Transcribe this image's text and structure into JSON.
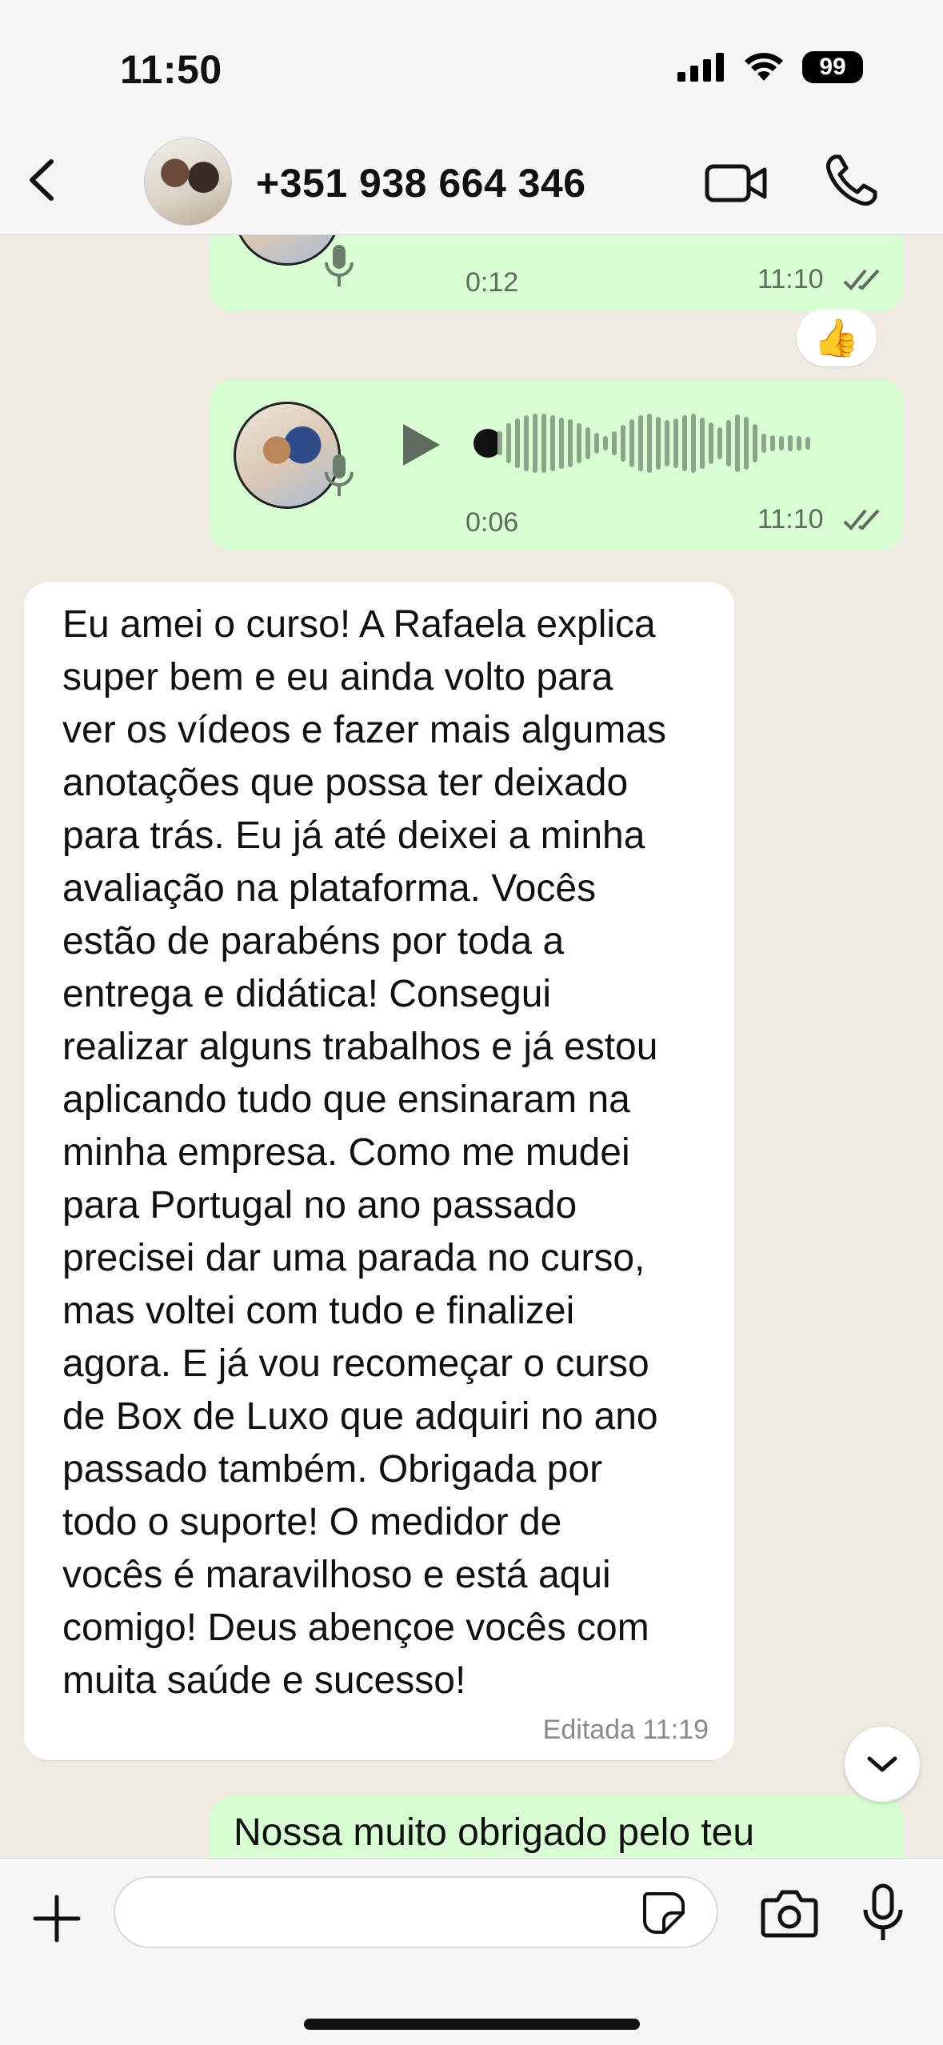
{
  "status_bar": {
    "time": "11:50",
    "battery": "99"
  },
  "header": {
    "contact_name": "+351 938 664 346"
  },
  "messages": {
    "voice_1": {
      "duration": "0:12",
      "time": "11:10",
      "reaction": "👍"
    },
    "voice_2": {
      "duration": "0:06",
      "time": "11:10"
    },
    "incoming_text": {
      "lines": [
        "Eu amei o curso! A Rafaela explica",
        "super bem e eu ainda volto para",
        "ver os vídeos e fazer mais algumas",
        "anotações que possa ter deixado",
        "para trás. Eu já até deixei a minha",
        "avaliação na plataforma. Vocês",
        "estão de parabéns por toda a",
        "entrega e didática! Consegui",
        "realizar alguns trabalhos e já estou",
        "aplicando tudo que ensinaram na",
        "minha empresa. Como me mudei",
        "para Portugal no ano passado",
        "precisei dar uma parada no curso,",
        "mas voltei com tudo e finalizei",
        "agora. E já vou recomeçar o curso",
        "de Box de Luxo que adquiri no ano",
        "passado também. Obrigada por",
        "todo o suporte! O medidor de",
        "vocês é maravilhoso e está aqui",
        "comigo! Deus abençoe vocês com",
        "muita saúde e sucesso!"
      ],
      "edited_label": "Editada 11:19"
    },
    "outgoing_partial": {
      "text": "Nossa muito obrigado pelo teu"
    }
  },
  "input": {
    "placeholder": ""
  }
}
